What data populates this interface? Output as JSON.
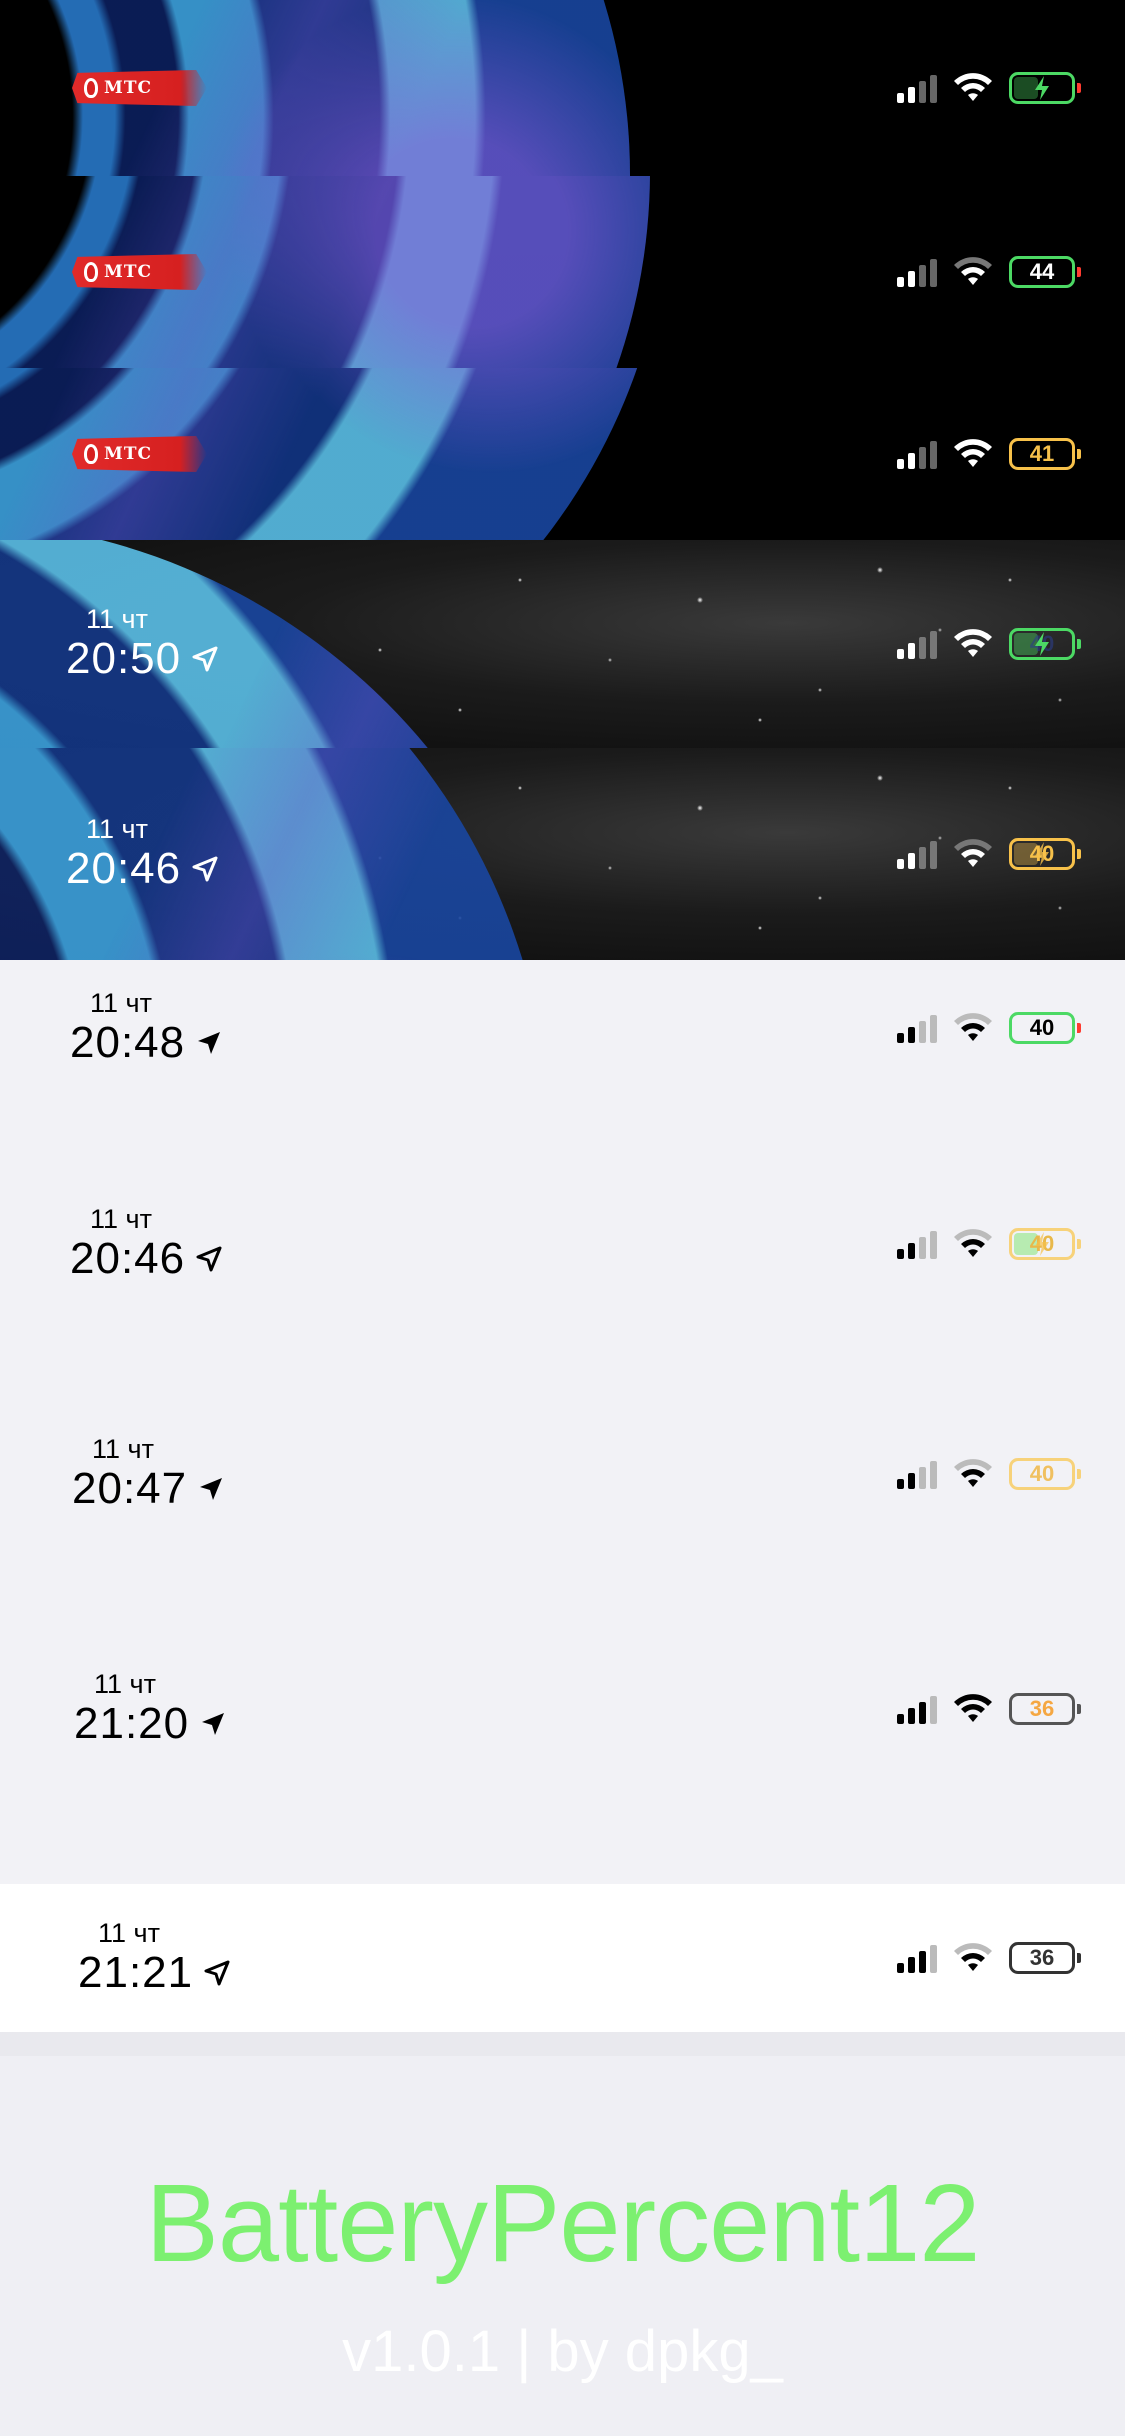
{
  "rows": [
    {
      "carrier": "МТС",
      "battery": {
        "text": "",
        "charging": true,
        "color": "#4cd964"
      }
    },
    {
      "carrier": "МТС",
      "battery": {
        "text": "44",
        "charging": false,
        "color": "#4cd964"
      }
    },
    {
      "carrier": "МТС",
      "battery": {
        "text": "41",
        "charging": false,
        "color": "#f7c14a"
      }
    },
    {
      "date": "11 чт",
      "time": "20:50",
      "battery": {
        "text": "40",
        "charging": true,
        "color": "#4cd964"
      }
    },
    {
      "date": "11 чт",
      "time": "20:46",
      "battery": {
        "text": "40",
        "charging": true,
        "color": "#f7c14a"
      }
    },
    {
      "date": "11 чт",
      "time": "20:48",
      "battery": {
        "text": "40",
        "charging": false,
        "color": "#4cd964"
      }
    },
    {
      "date": "11 чт",
      "time": "20:46",
      "battery": {
        "text": "40",
        "charging": true,
        "color": "#f7c14a"
      }
    },
    {
      "date": "11 чт",
      "time": "20:47",
      "battery": {
        "text": "40",
        "charging": false,
        "color": "#f7c14a"
      }
    },
    {
      "date": "11 чт",
      "time": "21:20",
      "battery": {
        "text": "36",
        "charging": false,
        "color": "#f5a742"
      }
    },
    {
      "date": "11 чт",
      "time": "21:21",
      "battery": {
        "text": "36",
        "charging": false,
        "color": "#333333"
      }
    }
  ],
  "footer": {
    "title": "BatteryPercent12",
    "subtitle": "v1.0.1 | by dpkg_"
  },
  "colors": {
    "accent_green": "#7cf070",
    "low_battery_red": "#ff3b30",
    "background": "#efeff4"
  },
  "icons": [
    "signal-icon",
    "wifi-icon",
    "battery-icon",
    "location-arrow-icon",
    "charging-bolt-icon",
    "carrier-logo"
  ]
}
